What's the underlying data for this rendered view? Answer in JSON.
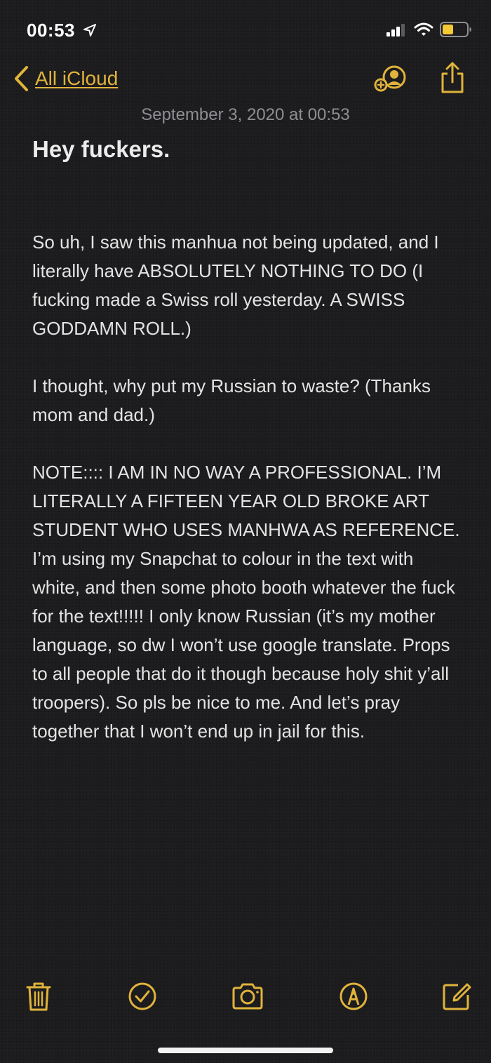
{
  "status_bar": {
    "time": "00:53",
    "icons": [
      "location-arrow-icon",
      "cellular-signal-icon",
      "wifi-icon",
      "battery-icon"
    ]
  },
  "nav": {
    "back_label": "All iCloud",
    "icons": [
      "chevron-left-icon",
      "add-people-icon",
      "share-icon"
    ]
  },
  "note": {
    "date": "September 3, 2020 at 00:53",
    "title": "Hey fuckers.",
    "paragraphs": [
      "So uh, I saw this manhua not being updated, and I literally have ABSOLUTELY NOTHING TO DO (I fucking made a Swiss roll yesterday. A SWISS GODDAMN ROLL.)",
      "I thought, why put my Russian to waste? (Thanks mom and dad.)",
      "NOTE:::: I AM IN NO WAY A PROFESSIONAL. I’M LITERALLY A FIFTEEN YEAR OLD BROKE ART STUDENT WHO USES MANHWA AS REFERENCE. I’m using my Snapchat to colour in the text with white, and then some photo booth whatever the fuck for the text!!!!! I only know Russian (it’s my mother language, so dw I won’t use google translate. Props to all people that do it though because holy shit y’all troopers). So pls be nice to me. And let’s pray together that I won’t end up in jail for this."
    ]
  },
  "toolbar": {
    "icons": [
      "trash-icon",
      "checklist-icon",
      "camera-icon",
      "markup-icon",
      "compose-icon"
    ]
  },
  "colors": {
    "accent": "#e0b33b",
    "background": "#1c1c1e",
    "text": "#e3e3e3",
    "secondary_text": "#8e8e93"
  }
}
